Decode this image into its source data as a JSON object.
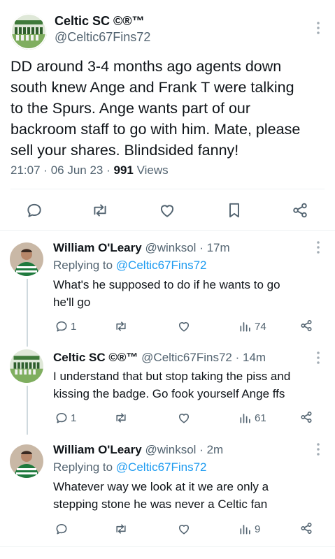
{
  "main_tweet": {
    "author_name": "Celtic SC ©®™",
    "author_handle": "@Celtic67Fins72",
    "text": "DD around 3-4 months ago agents down\nsouth knew Ange and Frank T were talking\nto the Spurs.  Ange wants part of our\nbackroom staff to go with him. Mate, please\nsell your shares. Blindsided fanny!",
    "time": "21:07",
    "date": "06 Jun 23",
    "views_count": "991",
    "views_label": "Views",
    "separator": "·",
    "icons": [
      "reply-icon",
      "retweet-icon",
      "like-icon",
      "bookmark-icon",
      "share-icon"
    ]
  },
  "replies": [
    {
      "author_name": "William O'Leary",
      "author_handle": "@winksol",
      "time": "17m",
      "replying_prefix": "Replying to",
      "replying_to": "@Celtic67Fins72",
      "text": "What's  he supposed to do  if he wants to go\nhe'll  go",
      "reply_count": "1",
      "retweet_count": "",
      "like_count": "",
      "view_count": "74"
    },
    {
      "author_name": "Celtic SC ©®™",
      "author_handle": "@Celtic67Fins72",
      "time": "14m",
      "replying_prefix": "",
      "replying_to": "",
      "text": "I understand that but stop taking the piss and\nkissing the badge.  Go fook yourself Ange ffs",
      "reply_count": "1",
      "retweet_count": "",
      "like_count": "",
      "view_count": "61"
    },
    {
      "author_name": "William O'Leary",
      "author_handle": "@winksol",
      "time": "2m",
      "replying_prefix": "Replying to",
      "replying_to": "@Celtic67Fins72",
      "text": "Whatever  way we look at  it we are only a\nstepping stone   he was never a Celtic  fan",
      "reply_count": "",
      "retweet_count": "",
      "like_count": "",
      "view_count": "9"
    }
  ],
  "colors": {
    "text_primary": "#0f1419",
    "text_secondary": "#536471",
    "link": "#1d9bf0",
    "border": "#eff3f4"
  }
}
